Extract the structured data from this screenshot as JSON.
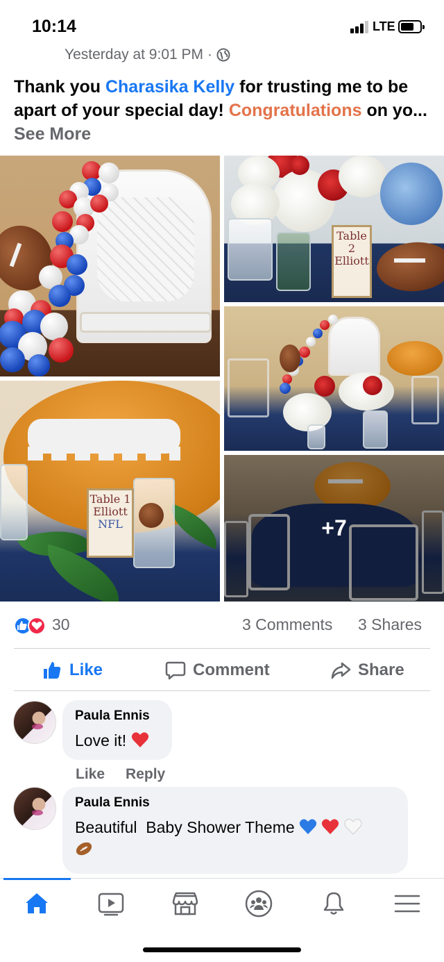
{
  "status_bar": {
    "time": "10:14",
    "network": "LTE",
    "signal_bars_filled": 3,
    "signal_bars_total": 4,
    "battery_level": 0.6
  },
  "post": {
    "timestamp": "Yesterday at 9:01 PM",
    "separator": "·",
    "privacy_icon": "globe-icon",
    "text_part1": "Thank you ",
    "mention": "Charasika Kelly",
    "text_part2": " for trusting me to be apart of your special day! ",
    "highlight": "Congratulations",
    "text_part3": " on yo...",
    "see_more": " See More"
  },
  "photos": {
    "card_text_1": "Table 2",
    "card_text_1b": "Elliott",
    "card_text_2": "Table 1",
    "card_text_2b": "Elliott",
    "card_text_2c": "NFL",
    "more_count": "+7"
  },
  "reactions": {
    "icons": [
      "like-icon",
      "love-icon"
    ],
    "count": "30",
    "comments": "3 Comments",
    "shares": "3 Shares"
  },
  "actions": {
    "like": "Like",
    "comment": "Comment",
    "share": "Share"
  },
  "comments": [
    {
      "name": "Paula Ennis",
      "text": "Love it!",
      "emoji": [
        "red-heart"
      ],
      "like_label": "Like",
      "reply_label": "Reply"
    },
    {
      "name": "Paula Ennis",
      "text": "Beautiful  Baby Shower Theme",
      "emoji": [
        "blue-heart",
        "red-heart",
        "white-heart",
        "football"
      ]
    }
  ],
  "colors": {
    "facebook_blue": "#1877f2",
    "highlight_orange": "#e3734a",
    "secondary_text": "#65676b",
    "love_red": "#f02849"
  },
  "bottom_nav": [
    "home-icon",
    "watch-icon",
    "marketplace-icon",
    "groups-icon",
    "notifications-icon",
    "menu-icon"
  ]
}
